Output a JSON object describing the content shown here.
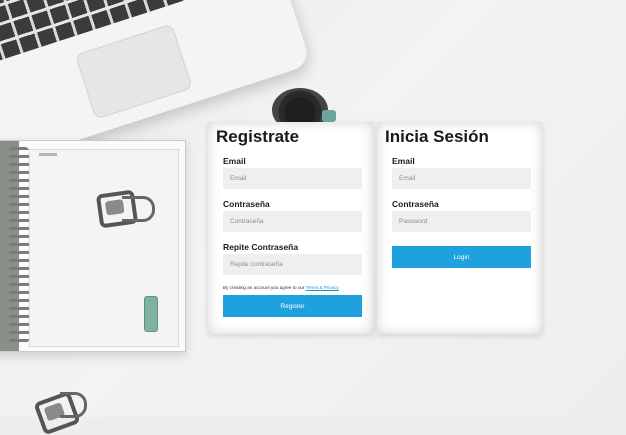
{
  "register": {
    "title": "Registrate",
    "email_label": "Email",
    "email_placeholder": "Email",
    "password_label": "Contraseña",
    "password_placeholder": "Contraseña",
    "repeat_label": "Repite Contraseña",
    "repeat_placeholder": "Repite contraseña",
    "terms_text": "By creating an account you agree to our",
    "terms_link": "Terms & Privacy",
    "button_label": "Register"
  },
  "login": {
    "title": "Inicia Sesión",
    "email_label": "Email",
    "email_placeholder": "Email",
    "password_label": "Contraseña",
    "password_placeholder": "Password",
    "button_label": "Login"
  },
  "colors": {
    "accent": "#1fa1de",
    "input_bg": "#efefef",
    "panel_bg": "#ffffff"
  }
}
